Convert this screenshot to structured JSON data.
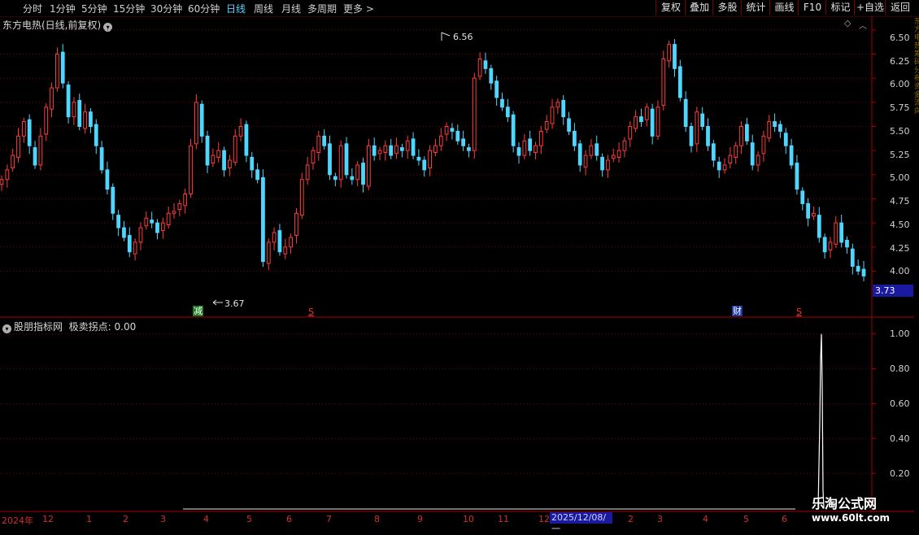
{
  "toolbar": {
    "periods": [
      {
        "label": "分时",
        "active": false
      },
      {
        "label": "1分钟",
        "active": false
      },
      {
        "label": "5分钟",
        "active": false
      },
      {
        "label": "15分钟",
        "active": false
      },
      {
        "label": "30分钟",
        "active": false
      },
      {
        "label": "60分钟",
        "active": false
      },
      {
        "label": "日线",
        "active": true
      },
      {
        "label": "周线",
        "active": false
      },
      {
        "label": "月线",
        "active": false
      },
      {
        "label": "多周期",
        "active": false
      },
      {
        "label": "更多",
        "active": false
      }
    ],
    "more_arrow": ">",
    "right_buttons": [
      "复权",
      "叠加",
      "多股",
      "统计",
      "画线",
      "F10",
      "标记",
      "+自选",
      "返回"
    ]
  },
  "main_chart": {
    "title": "东方电热(日线,前复权)",
    "price_labels": [
      "6.50",
      "6.25",
      "6.00",
      "5.75",
      "5.50",
      "5.25",
      "5.00",
      "4.75",
      "4.50",
      "4.25",
      "4.00"
    ],
    "last_price": "3.73",
    "high_marker": "6.56",
    "low_marker": "3.67",
    "signals": [
      {
        "text": "减",
        "bg": "#1e7a1e",
        "fg": "#ffffff"
      },
      {
        "text": "S",
        "bg": "transparent",
        "fg": "#ff3030"
      },
      {
        "text": "财",
        "bg": "#1a3aa0",
        "fg": "#ffffff"
      },
      {
        "text": "S",
        "bg": "transparent",
        "fg": "#ff3030"
      }
    ]
  },
  "indicator": {
    "name": "股朋指标网",
    "line_label": "极卖拐点: 0.00",
    "axis_labels": [
      "1.00",
      "0.80",
      "0.60",
      "0.40",
      "0.20"
    ]
  },
  "date_axis": {
    "labels": [
      "2024年",
      "12",
      "1",
      "2",
      "3",
      "4",
      "5",
      "6",
      "7",
      "8",
      "9",
      "10",
      "11",
      "12",
      "2",
      "3",
      "4",
      "5",
      "6"
    ],
    "cursor_date": "2025/12/08/一"
  },
  "right_strip_text": "东方电热筹码分布资金流向",
  "watermark": {
    "title": "乐淘公式网",
    "url": "www.60lt.com"
  },
  "colors": {
    "up": "#ff3c3c",
    "down": "#4fd6ff",
    "grid": "#7a0000",
    "axis": "#aa0000",
    "indicator_line": "#ffffff"
  },
  "chart_data": {
    "type": "candlestick",
    "title": "东方电热(日线,前复权)",
    "ylim": [
      3.65,
      6.6
    ],
    "close_series": [
      4.95,
      5.05,
      5.2,
      5.4,
      5.55,
      5.3,
      5.1,
      5.4,
      5.7,
      5.9,
      6.25,
      5.95,
      5.6,
      5.75,
      5.5,
      5.65,
      5.5,
      5.3,
      5.05,
      4.85,
      4.6,
      4.45,
      4.35,
      4.2,
      4.3,
      4.45,
      4.55,
      4.5,
      4.4,
      4.5,
      4.6,
      4.62,
      4.7,
      4.8,
      5.3,
      5.75,
      5.4,
      5.1,
      5.2,
      5.25,
      5.05,
      5.15,
      5.4,
      5.5,
      5.2,
      5.05,
      4.95,
      4.1,
      4.3,
      4.4,
      4.2,
      4.25,
      4.35,
      4.6,
      4.95,
      5.1,
      5.25,
      5.4,
      5.3,
      5.0,
      4.95,
      5.3,
      5.0,
      4.95,
      5.1,
      4.9,
      5.3,
      5.2,
      5.25,
      5.3,
      5.2,
      5.3,
      5.25,
      5.35,
      5.2,
      5.15,
      5.05,
      5.25,
      5.3,
      5.4,
      5.5,
      5.45,
      5.35,
      5.3,
      5.25,
      6.0,
      6.2,
      6.1,
      5.95,
      5.8,
      5.7,
      5.6,
      5.3,
      5.2,
      5.35,
      5.25,
      5.3,
      5.45,
      5.55,
      5.7,
      5.75,
      5.6,
      5.45,
      5.3,
      5.1,
      5.2,
      5.3,
      5.2,
      5.05,
      5.15,
      5.2,
      5.25,
      5.35,
      5.5,
      5.6,
      5.55,
      5.7,
      5.4,
      5.7,
      6.2,
      6.35,
      6.1,
      5.8,
      5.5,
      5.3,
      5.65,
      5.5,
      5.3,
      5.15,
      5.05,
      5.1,
      5.2,
      5.3,
      5.5,
      5.35,
      5.1,
      5.2,
      5.4,
      5.55,
      5.5,
      5.45,
      5.3,
      5.1,
      4.85,
      4.7,
      4.55,
      4.6,
      4.35,
      4.2,
      4.3,
      4.5,
      4.3,
      4.25,
      4.05,
      4.0,
      3.95
    ],
    "indicator_series": {
      "name": "极卖拐点",
      "spike_value": 1.0,
      "current_value": 0.0
    }
  }
}
